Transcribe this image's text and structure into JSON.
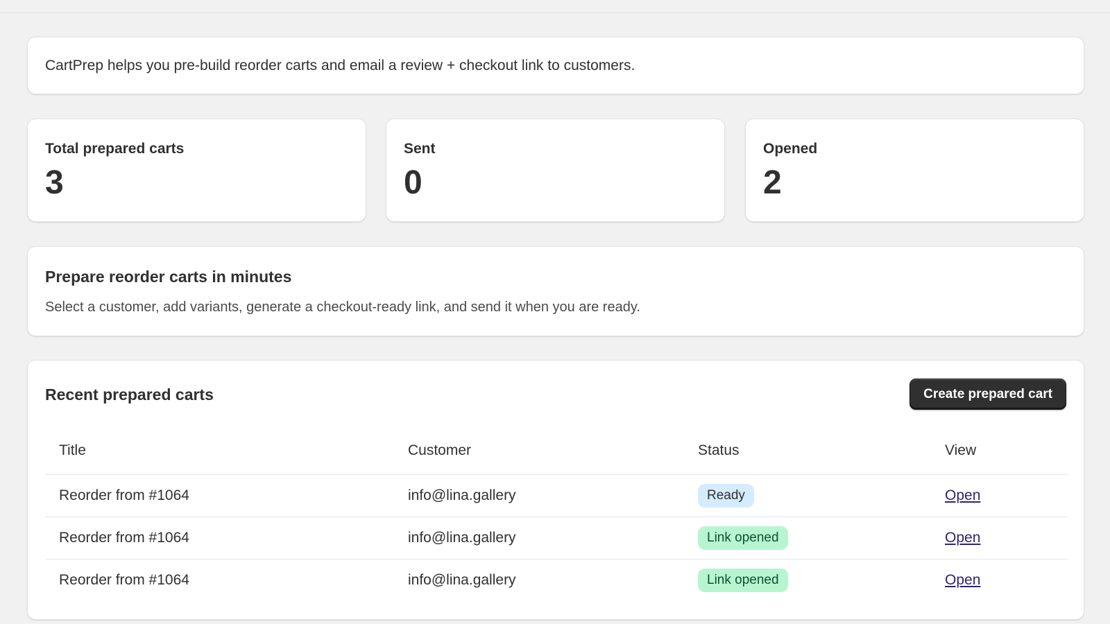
{
  "intro": {
    "text": "CartPrep helps you pre-build reorder carts and email a review + checkout link to customers."
  },
  "stats": {
    "total": {
      "label": "Total prepared carts",
      "value": "3"
    },
    "sent": {
      "label": "Sent",
      "value": "0"
    },
    "opened": {
      "label": "Opened",
      "value": "2"
    }
  },
  "promo": {
    "heading": "Prepare reorder carts in minutes",
    "body": "Select a customer, add variants, generate a checkout-ready link, and send it when you are ready."
  },
  "recent": {
    "heading": "Recent prepared carts",
    "create_button": "Create prepared cart",
    "columns": [
      "Title",
      "Customer",
      "Status",
      "View"
    ],
    "rows": [
      {
        "title": "Reorder from #1064",
        "customer": "info@lina.gallery",
        "status": "Ready",
        "view": "Open"
      },
      {
        "title": "Reorder from #1064",
        "customer": "info@lina.gallery",
        "status": "Link opened",
        "view": "Open"
      },
      {
        "title": "Reorder from #1064",
        "customer": "info@lina.gallery",
        "status": "Link opened",
        "view": "Open"
      }
    ]
  },
  "colors": {
    "background": "#f1f1f1",
    "card": "#ffffff",
    "primary_button": "#303030",
    "badge_ready": "#d5ebff",
    "badge_opened": "#b7f5d1",
    "link": "#2c2475"
  }
}
